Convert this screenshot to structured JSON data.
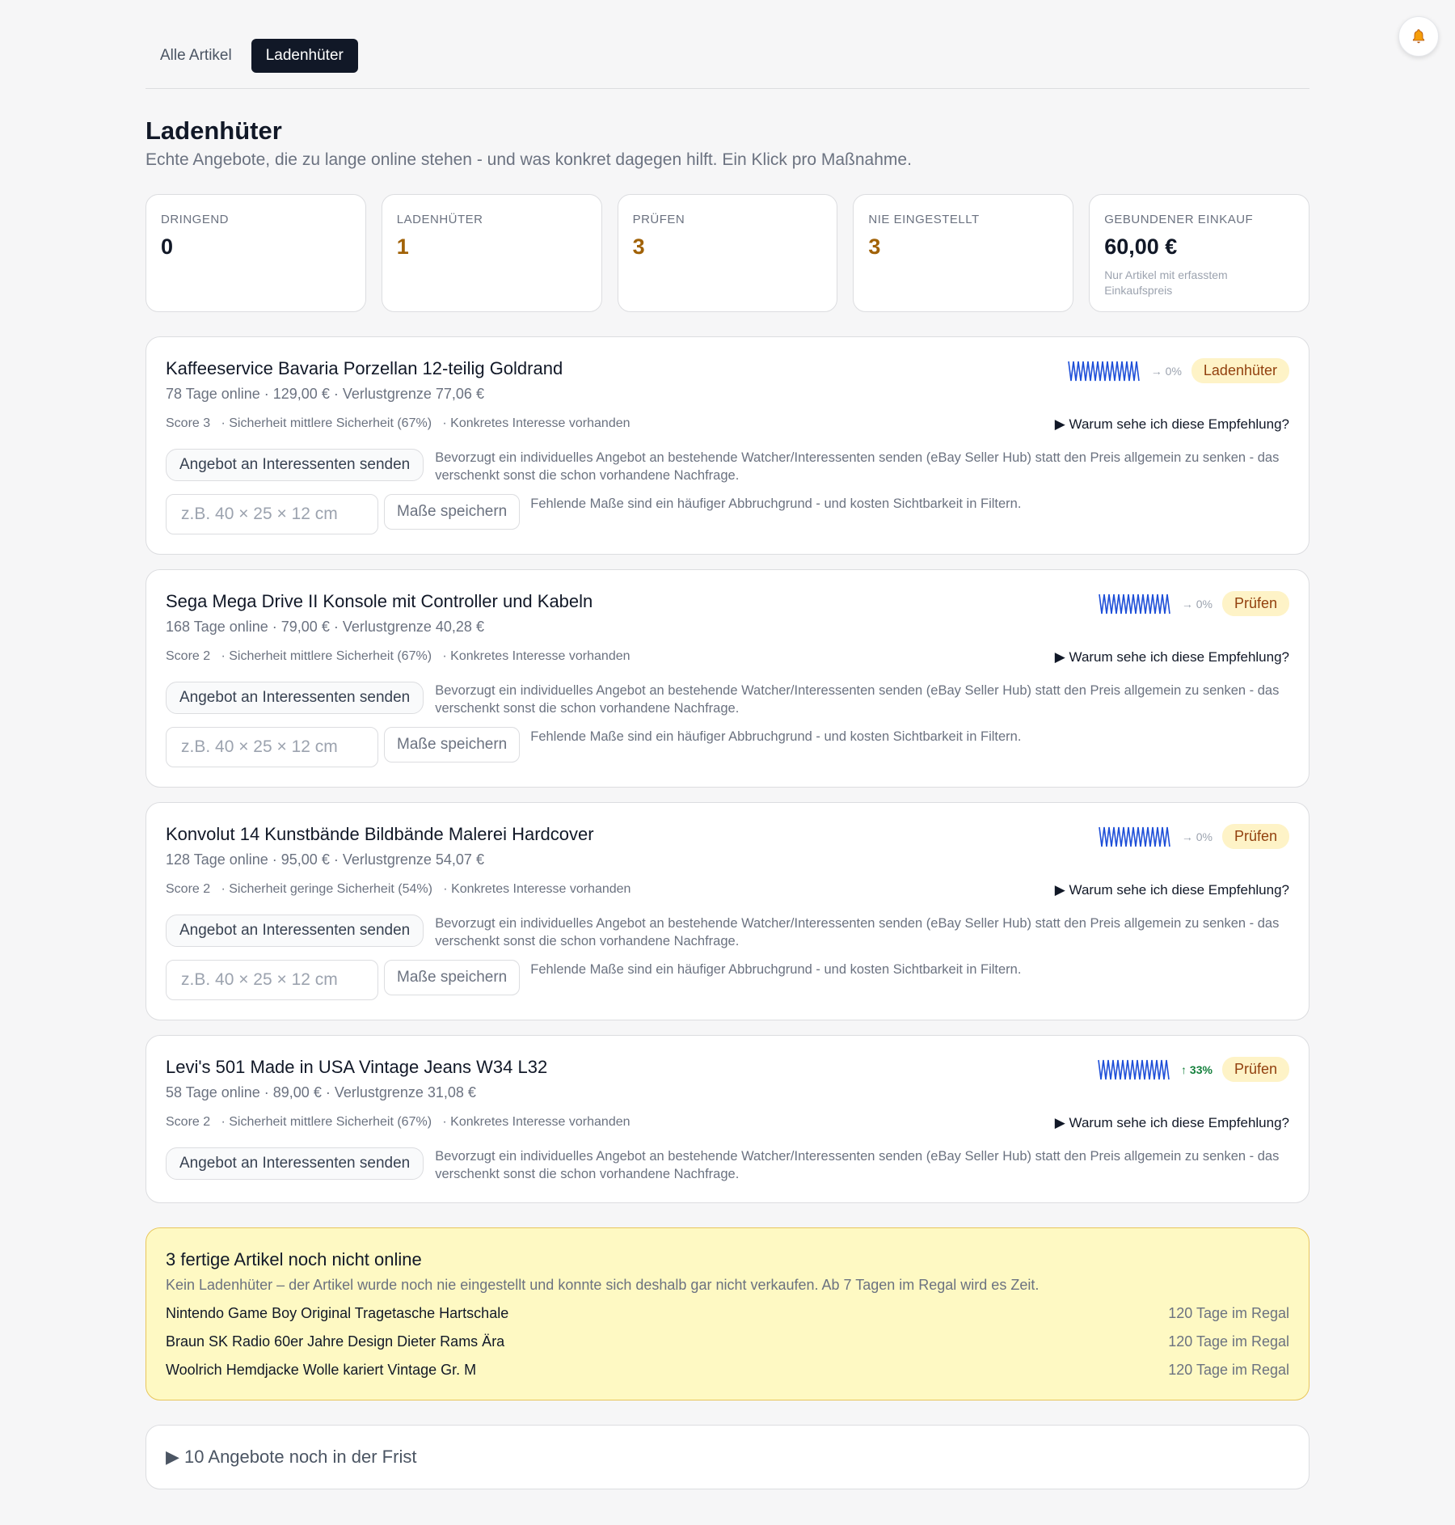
{
  "tabs": [
    {
      "label": "Alle Artikel"
    },
    {
      "label": "Ladenhüter"
    }
  ],
  "header": {
    "title": "Ladenhüter",
    "subtitle": "Echte Angebote, die zu lange online stehen - und was konkret dagegen hilft. Ein Klick pro Maßnahme."
  },
  "kpis": [
    {
      "label": "DRINGEND",
      "value": "0"
    },
    {
      "label": "LADENHÜTER",
      "value": "1"
    },
    {
      "label": "PRÜFEN",
      "value": "3"
    },
    {
      "label": "NIE EINGESTELLT",
      "value": "3"
    },
    {
      "label": "GEBUNDENER EINKAUF",
      "value": "60,00 €",
      "note": "Nur Artikel mit erfasstem Einkaufspreis"
    }
  ],
  "items": [
    {
      "title": "Kaffeeservice Bavaria Porzellan 12-teilig Goldrand",
      "meta": "78 Tage online · 129,00 € · Verlustgrenze 77,06 €",
      "score": "Score 3",
      "certainty": "· Sicherheit mittlere Sicherheit (67%)",
      "interest": "· Konkretes Interesse vorhanden",
      "why": "▶ Warum sehe ich diese Empfehlung?",
      "trend": "→ 0%",
      "badge": "Ladenhüter",
      "action_label": "Angebot an Interessenten senden",
      "action_desc": "Bevorzugt ein individuelles Angebot an bestehende Watcher/Interessenten senden (eBay Seller Hub) statt den Preis allgemein zu senken - das verschenkt sonst die schon vorhandene Nachfrage.",
      "size_placeholder": "z.B. 40 × 25 × 12 cm",
      "size_button": "Maße speichern",
      "size_note": "Fehlende Maße sind ein häufiger Abbruchgrund - und kosten Sichtbarkeit in Filtern."
    },
    {
      "title": "Sega Mega Drive II Konsole mit Controller und Kabeln",
      "meta": "168 Tage online · 79,00 € · Verlustgrenze 40,28 €",
      "score": "Score 2",
      "certainty": "· Sicherheit mittlere Sicherheit (67%)",
      "interest": "· Konkretes Interesse vorhanden",
      "why": "▶ Warum sehe ich diese Empfehlung?",
      "trend": "→ 0%",
      "badge": "Prüfen",
      "action_label": "Angebot an Interessenten senden",
      "action_desc": "Bevorzugt ein individuelles Angebot an bestehende Watcher/Interessenten senden (eBay Seller Hub) statt den Preis allgemein zu senken - das verschenkt sonst die schon vorhandene Nachfrage.",
      "size_placeholder": "z.B. 40 × 25 × 12 cm",
      "size_button": "Maße speichern",
      "size_note": "Fehlende Maße sind ein häufiger Abbruchgrund - und kosten Sichtbarkeit in Filtern."
    },
    {
      "title": "Konvolut 14 Kunstbände Bildbände Malerei Hardcover",
      "meta": "128 Tage online · 95,00 € · Verlustgrenze 54,07 €",
      "score": "Score 2",
      "certainty": "· Sicherheit geringe Sicherheit (54%)",
      "interest": "· Konkretes Interesse vorhanden",
      "why": "▶ Warum sehe ich diese Empfehlung?",
      "trend": "→ 0%",
      "badge": "Prüfen",
      "action_label": "Angebot an Interessenten senden",
      "action_desc": "Bevorzugt ein individuelles Angebot an bestehende Watcher/Interessenten senden (eBay Seller Hub) statt den Preis allgemein zu senken - das verschenkt sonst die schon vorhandene Nachfrage.",
      "size_placeholder": "z.B. 40 × 25 × 12 cm",
      "size_button": "Maße speichern",
      "size_note": "Fehlende Maße sind ein häufiger Abbruchgrund - und kosten Sichtbarkeit in Filtern."
    },
    {
      "title": "Levi's 501 Made in USA Vintage Jeans W34 L32",
      "meta": "58 Tage online · 89,00 € · Verlustgrenze 31,08 €",
      "score": "Score 2",
      "certainty": "· Sicherheit mittlere Sicherheit (67%)",
      "interest": "· Konkretes Interesse vorhanden",
      "why": "▶ Warum sehe ich diese Empfehlung?",
      "trend": "↑ 33%",
      "badge": "Prüfen",
      "action_label": "Angebot an Interessenten senden",
      "action_desc": "Bevorzugt ein individuelles Angebot an bestehende Watcher/Interessenten senden (eBay Seller Hub) statt den Preis allgemein zu senken - das verschenkt sonst die schon vorhandene Nachfrage."
    }
  ],
  "not_online": {
    "title": "3 fertige Artikel noch nicht online",
    "subtitle": "Kein Ladenhüter – der Artikel wurde noch nie eingestellt und konnte sich deshalb gar nicht verkaufen. Ab 7 Tagen im Regal wird es Zeit.",
    "rows": [
      {
        "name": "Nintendo Game Boy Original Tragetasche Hartschale",
        "days": "120 Tage im Regal"
      },
      {
        "name": "Braun SK Radio 60er Jahre Design Dieter Rams Ära",
        "days": "120 Tage im Regal"
      },
      {
        "name": "Woolrich Hemdjacke Wolle kariert Vintage Gr. M",
        "days": "120 Tage im Regal"
      }
    ]
  },
  "collapsed": {
    "label": "▶ 10 Angebote noch in der Frist"
  },
  "colors": {
    "accent": "#111827",
    "spark": "#1d4ed8",
    "badge_bg": "#fef3c7",
    "warn_bg": "#fef9c3",
    "up": "#15803d"
  },
  "icons": {
    "notification": "bell-icon"
  }
}
